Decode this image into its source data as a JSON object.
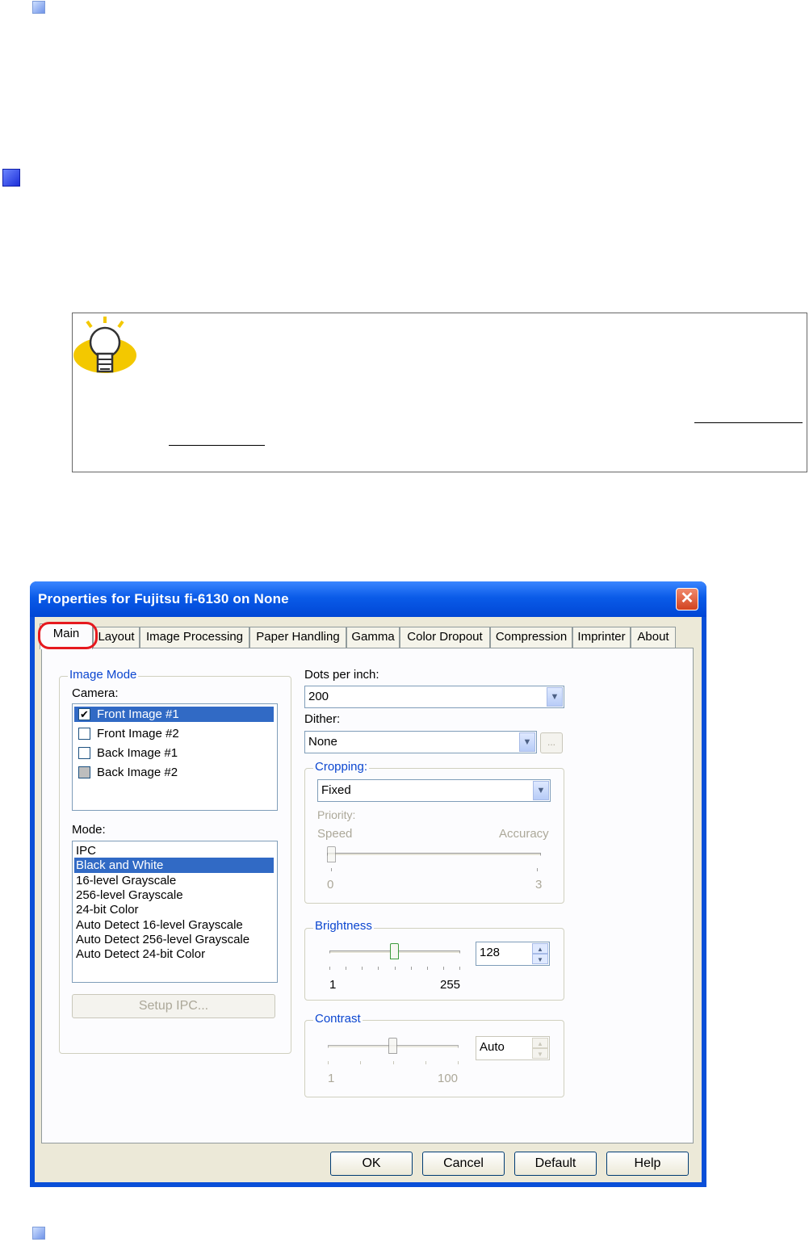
{
  "dialog": {
    "title": "Properties for Fujitsu fi-6130 on None",
    "close_glyph": "✕",
    "tabs": [
      "Main",
      "Layout",
      "Image Processing",
      "Paper Handling",
      "Gamma",
      "Color Dropout",
      "Compression",
      "Imprinter",
      "About"
    ],
    "active_tab": "Main",
    "image_mode": {
      "group_label": "Image Mode",
      "camera_label": "Camera:",
      "cameras": [
        {
          "label": "Front Image #1",
          "checked": true
        },
        {
          "label": "Front Image #2",
          "checked": false
        },
        {
          "label": "Back Image #1",
          "checked": false
        },
        {
          "label": "Back Image #2",
          "checked": false
        }
      ],
      "mode_label": "Mode:",
      "modes": [
        "IPC",
        "Black and White",
        "16-level Grayscale",
        "256-level Grayscale",
        "24-bit Color",
        "Auto Detect 16-level Grayscale",
        "Auto Detect 256-level Grayscale",
        "Auto Detect 24-bit Color"
      ],
      "selected_mode": "Black and White",
      "setup_ipc_label": "Setup IPC..."
    },
    "dpi": {
      "label": "Dots per inch:",
      "value": "200"
    },
    "dither": {
      "label": "Dither:",
      "value": "None",
      "more_button": "..."
    },
    "cropping": {
      "group_label": "Cropping:",
      "value": "Fixed",
      "priority_label": "Priority:",
      "speed_label": "Speed",
      "accuracy_label": "Accuracy",
      "min": "0",
      "max": "3",
      "level": 0
    },
    "brightness": {
      "group_label": "Brightness",
      "value": "128",
      "min": "1",
      "max": "255",
      "level": 128
    },
    "contrast": {
      "group_label": "Contrast",
      "value": "Auto",
      "min": "1",
      "max": "100",
      "level": 50
    },
    "buttons": {
      "ok": "OK",
      "cancel": "Cancel",
      "default": "Default",
      "help": "Help"
    },
    "icons": {
      "dropdown": "chevron-down-icon",
      "spin_up": "▲",
      "spin_down": "▼",
      "check": "✔"
    }
  }
}
